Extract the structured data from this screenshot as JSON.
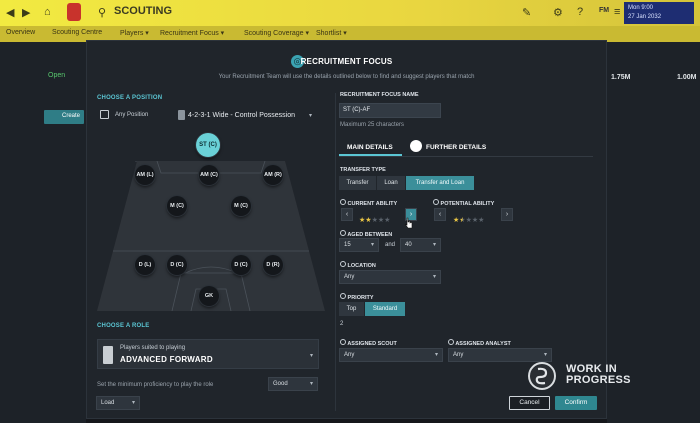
{
  "app": {
    "page_title": "SCOUTING",
    "date": [
      "Mon 9:00",
      "27 Jan 2032"
    ],
    "fm_label": "FM",
    "tabs": [
      "Overview",
      "Scouting Centre",
      "Players ▾",
      "Recruitment Focus ▾",
      "Scouting Coverage ▾",
      "Shortlist ▾"
    ]
  },
  "background": {
    "open_label": "Open",
    "create_label": "Create",
    "values": [
      "1.75M",
      "1.00M"
    ]
  },
  "modal": {
    "title": "RECRUITMENT FOCUS",
    "subtitle": "Your Recruitment Team will use the details outlined below to find and suggest players that match",
    "choose_position": "CHOOSE A POSITION",
    "any_position": "Any Position",
    "formation": "4-2-3-1 Wide - Control Possession",
    "positions": {
      "st": "ST (C)",
      "aml": "AM (L)",
      "amc": "AM (C)",
      "amr": "AM (R)",
      "mc1": "M (C)",
      "mc2": "M (C)",
      "dl": "D (L)",
      "dc1": "D (C)",
      "dc2": "D (C)",
      "dr": "D (R)",
      "gk": "GK"
    },
    "choose_role": "CHOOSE A ROLE",
    "role_caption": "Players suited to playing",
    "role_name": "ADVANCED FORWARD",
    "proficiency_label": "Set the minimum proficiency to play the role",
    "proficiency_value": "Good",
    "load_label": "Load",
    "focus_name_label": "RECRUITMENT FOCUS NAME",
    "focus_name_value": "ST (C)-AF",
    "max_chars": "Maximum 25 characters",
    "tab_main": "MAIN DETAILS",
    "tab_further": "FURTHER DETAILS",
    "transfer_type_label": "TRANSFER TYPE",
    "transfer_options": [
      "Transfer",
      "Loan",
      "Transfer and Loan"
    ],
    "current_ability_label": "CURRENT ABILITY",
    "current_ability_stars": 2,
    "potential_ability_label": "POTENTIAL ABILITY",
    "potential_ability_stars": 2.5,
    "aged_between_label": "AGED BETWEEN",
    "age_min": "15",
    "age_and": "and",
    "age_max": "40",
    "location_label": "LOCATION",
    "location_value": "Any",
    "priority_label": "PRIORITY",
    "priority_options": [
      "Top",
      "Standard"
    ],
    "priority_value": "2",
    "assigned_scout_label": "ASSIGNED SCOUT",
    "assigned_scout_value": "Any",
    "assigned_analyst_label": "ASSIGNED ANALYST",
    "assigned_analyst_value": "Any",
    "cancel_label": "Cancel",
    "confirm_label": "Confirm"
  },
  "watermark": [
    "WORK IN",
    "PROGRESS"
  ],
  "colors": {
    "accent": "#5bc6d4",
    "button": "#2f8790",
    "topbar": "#f2ea41",
    "star": "#e9c545"
  }
}
